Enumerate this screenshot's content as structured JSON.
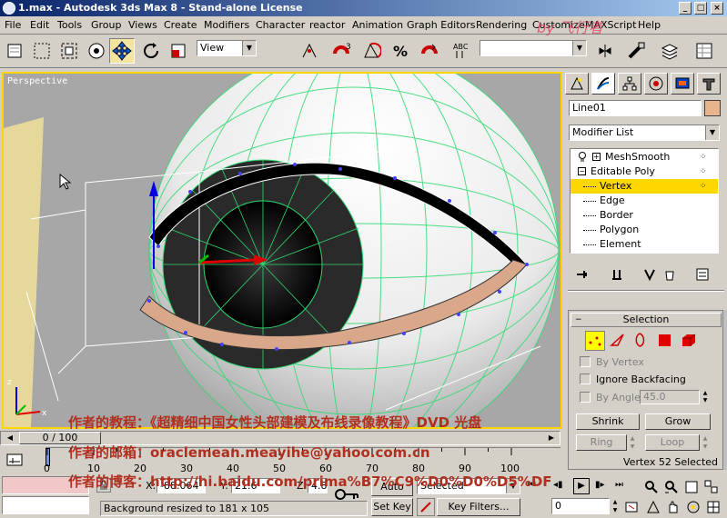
{
  "window": {
    "title": "1.max - Autodesk 3ds Max 8   - Stand-alone License",
    "buttons": [
      "_",
      "□",
      "×"
    ]
  },
  "menu": [
    "File",
    "Edit",
    "Tools",
    "Group",
    "Views",
    "Create",
    "Modifiers",
    "Character",
    "reactor",
    "Animation",
    "Graph Editors",
    "Rendering",
    "Customize",
    "MAXScript",
    "Help"
  ],
  "toolbar": {
    "view_combo": "View",
    "selection_set_combo": ""
  },
  "viewport": {
    "label": "Perspective",
    "axis_x": "x",
    "axis_z": "z"
  },
  "command_panel": {
    "object_name": "Line01",
    "object_color": "#e8b48c",
    "modifier_list_label": "Modifier List",
    "stack": [
      {
        "label": "MeshSmooth",
        "level": 0
      },
      {
        "label": "Editable Poly",
        "level": 0
      },
      {
        "label": "Vertex",
        "level": 1,
        "selected": true
      },
      {
        "label": "Edge",
        "level": 1
      },
      {
        "label": "Border",
        "level": 1
      },
      {
        "label": "Polygon",
        "level": 1
      },
      {
        "label": "Element",
        "level": 1
      }
    ],
    "selection_rollout": {
      "title": "Selection",
      "by_vertex": "By Vertex",
      "ignore_backfacing": "Ignore Backfacing",
      "by_angle": "By Angle:",
      "angle_value": "45.0",
      "shrink": "Shrink",
      "grow": "Grow",
      "ring": "Ring",
      "loop": "Loop",
      "status": "Vertex 52 Selected"
    }
  },
  "timeline": {
    "frame_label": "0 / 100",
    "ticks": [
      "0",
      "10",
      "20",
      "30",
      "40",
      "50",
      "60",
      "70",
      "80",
      "90",
      "100"
    ]
  },
  "status_bar": {
    "x_label": "X:",
    "x_value": "-88.064",
    "y_label": "Y:",
    "y_value": "21.6",
    "z_label": "Z:",
    "z_value": "4.8",
    "auto_key": "Auto Key",
    "set_key": "Set Key",
    "selected": "Selected",
    "key_filters": "Key Filters...",
    "frame_value": "0",
    "prompt": "Background resized to 181 x 105"
  },
  "overlay_text": {
    "line1": "作者的教程：《超精细中国女性头部建模及布线录像教程》DVD 光盘",
    "line2": "作者的邮箱：oraclemean.meayihe@yahoo.com.cn",
    "line3": "作者的博客：http://hi.baidu.com/prima%B7%C9%D0%D0%D5%DF",
    "watermark": "by 飞行者"
  }
}
